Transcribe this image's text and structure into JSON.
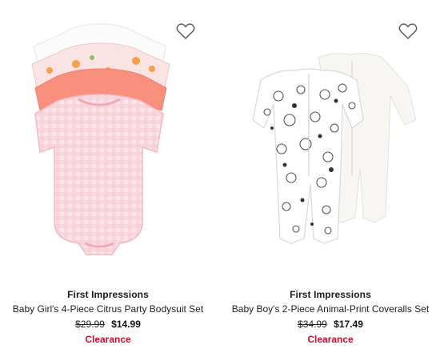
{
  "products": [
    {
      "brand": "First Impressions",
      "name": "Baby Girl's 4-Piece Citrus Party Bodysuit Set",
      "original_price": "$29.99",
      "sale_price": "$14.99",
      "badge": "Clearance",
      "wishlist_icon": "heart-outline-icon"
    },
    {
      "brand": "First Impressions",
      "name": "Baby Boy's 2-Piece Animal-Print Coveralls Set",
      "original_price": "$34.99",
      "sale_price": "$17.49",
      "badge": "Clearance",
      "wishlist_icon": "heart-outline-icon"
    }
  ],
  "colors": {
    "clearance": "#c8102e",
    "pink_light": "#f7d6db",
    "coral": "#f7907a",
    "icon_outline": "#555555"
  }
}
